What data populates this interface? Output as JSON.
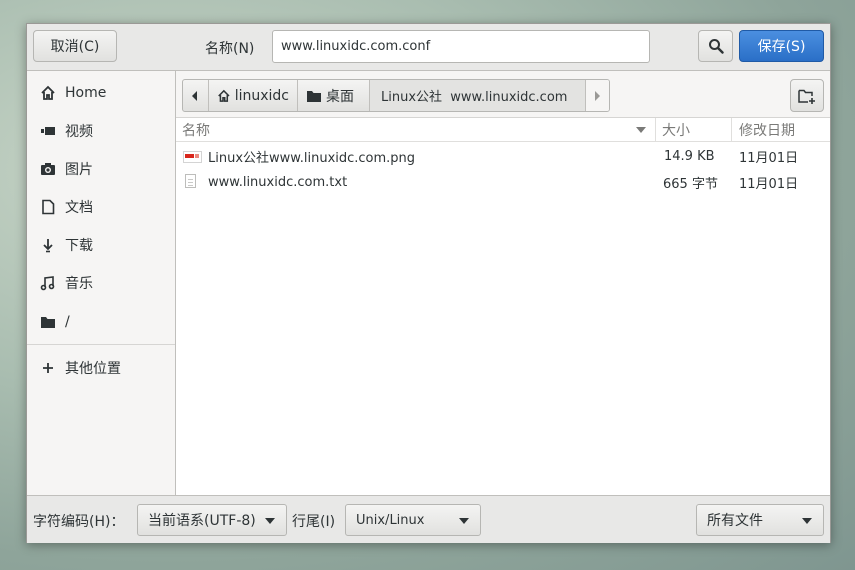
{
  "header": {
    "cancel_label": "取消(C)",
    "name_label": "名称(N)",
    "filename_value": "www.linuxidc.com.conf",
    "save_label": "保存(S)"
  },
  "sidebar": {
    "items": [
      {
        "label": "Home",
        "icon": "home-icon"
      },
      {
        "label": "视频",
        "icon": "video-icon"
      },
      {
        "label": "图片",
        "icon": "camera-icon"
      },
      {
        "label": "文档",
        "icon": "document-icon"
      },
      {
        "label": "下载",
        "icon": "download-icon"
      },
      {
        "label": "音乐",
        "icon": "music-icon"
      },
      {
        "label": "/",
        "icon": "folder-icon"
      }
    ],
    "other_locations": "其他位置"
  },
  "pathbar": {
    "segments": [
      "linuxidc",
      "桌面",
      "Linux公社  www.linuxidc.com"
    ]
  },
  "filelist": {
    "columns": {
      "name": "名称",
      "size": "大小",
      "modified": "修改日期"
    },
    "rows": [
      {
        "name": "Linux公社www.linuxidc.com.png",
        "size": "14.9 KB",
        "modified": "11月01日",
        "icon": "image-file-icon"
      },
      {
        "name": "www.linuxidc.com.txt",
        "size": "665 字节",
        "modified": "11月01日",
        "icon": "text-file-icon"
      }
    ]
  },
  "bottom": {
    "encoding_label": "字符编码(H)：",
    "encoding_value": "当前语系(UTF-8)",
    "line_ending_label": "行尾(I)",
    "line_ending_value": "Unix/Linux",
    "filter_value": "所有文件"
  },
  "colors": {
    "accent": "#3584e4",
    "sidebar_bg": "#f6f5f4",
    "header_bg": "#e8e8e7"
  }
}
